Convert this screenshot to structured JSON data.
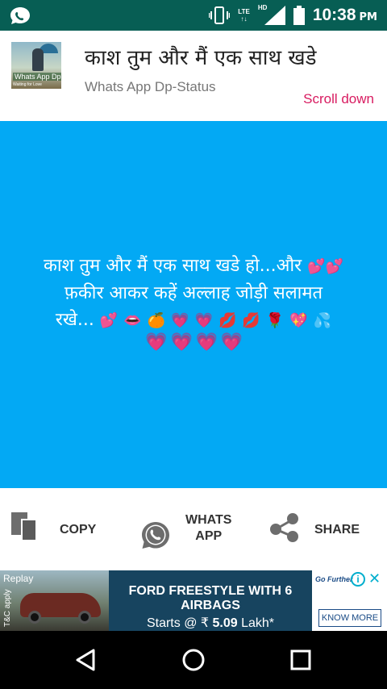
{
  "status_bar": {
    "time": "10:38",
    "ampm": "PM",
    "network_type": "LTE",
    "hd_label": "HD",
    "icons": [
      "whatsapp-notification-icon",
      "vibrate-icon",
      "signal-icon",
      "battery-icon"
    ]
  },
  "header": {
    "title": "काश तुम और मैं एक साथ खडे",
    "subtitle": "Whats App Dp-Status",
    "scroll_hint": "Scroll down",
    "thumbnail_text": "Whats App Dp",
    "thumbnail_subtext": "Waiting for Love",
    "accent_color": "#d81b60"
  },
  "message": {
    "line1": "काश तुम और मैं एक साथ खडे हो...और",
    "line2": "फ़कीर आकर कहें  अल्लाह जोड़ी सलामत",
    "line3": "रखे...",
    "background_color": "#03a9f4",
    "emoji_line1_end": "💕💕",
    "emoji_line3": [
      "💕",
      "👄",
      "🍊",
      "💗",
      "💗",
      "💋",
      "💋",
      "🌹",
      "💖",
      "💦"
    ],
    "emoji_line4": [
      "💗",
      "💗",
      "💗",
      "💗"
    ]
  },
  "actions": {
    "copy_label": "COPY",
    "whatsapp_label_1": "WHATS",
    "whatsapp_label_2": "APP",
    "share_label": "SHARE"
  },
  "ad": {
    "replay_label": "Replay",
    "tc_label": "T&C apply",
    "headline": "FORD FREESTYLE WITH 6 AIRBAGS",
    "price_prefix": "Starts @ ₹",
    "price_value": "5.09",
    "price_suffix": "Lakh*",
    "brand_tagline": "Go Further",
    "cta_label": "KNOW MORE",
    "info_icon": "i",
    "close_icon": "✕"
  },
  "nav_bar": {
    "buttons": [
      "back-icon",
      "home-icon",
      "recent-apps-icon"
    ]
  }
}
